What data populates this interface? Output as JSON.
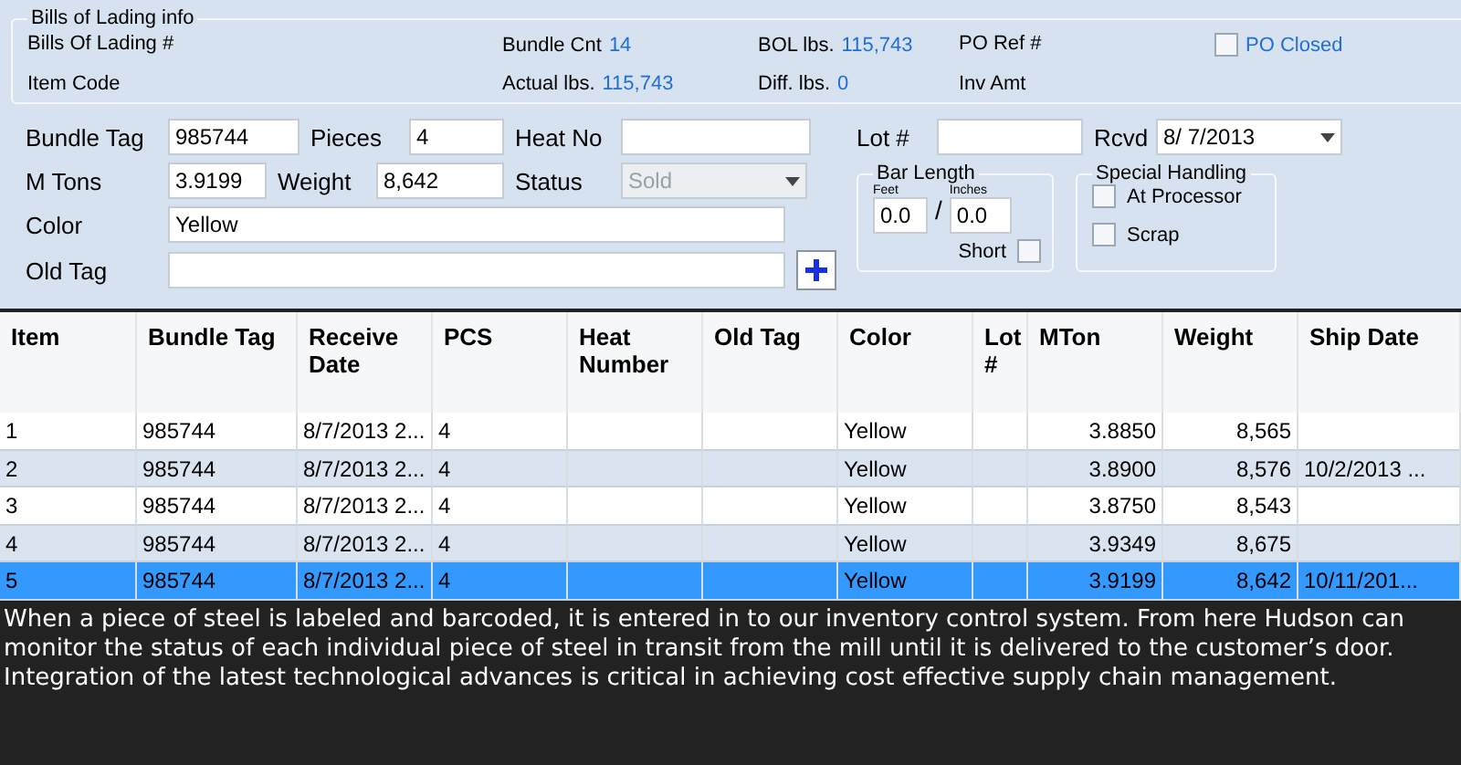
{
  "bol_info": {
    "title": "Bills of Lading info",
    "bol_label": "Bills Of Lading #",
    "item_code_label": "Item Code",
    "bundle_cnt_label": "Bundle Cnt",
    "bundle_cnt": "14",
    "actual_lbs_label": "Actual lbs.",
    "actual_lbs": "115,743",
    "bol_lbs_label": "BOL lbs.",
    "bol_lbs": "115,743",
    "diff_lbs_label": "Diff. lbs.",
    "diff_lbs": "0",
    "po_ref_label": "PO Ref #",
    "inv_amt_label": "Inv Amt",
    "po_closed": {
      "label": "PO Closed",
      "checked": false
    }
  },
  "form": {
    "bundle_tag": {
      "label": "Bundle Tag",
      "value": "985744"
    },
    "pieces": {
      "label": "Pieces",
      "value": "4"
    },
    "heat_no": {
      "label": "Heat No"
    },
    "lot": {
      "label": "Lot #"
    },
    "rcvd": {
      "label": "Rcvd",
      "value": "8/ 7/2013"
    },
    "m_tons": {
      "label": "M Tons",
      "value": "3.9199"
    },
    "weight": {
      "label": "Weight",
      "value": "8,642"
    },
    "status": {
      "label": "Status",
      "value": "Sold",
      "disabled": true
    },
    "color": {
      "label": "Color",
      "value": "Yellow"
    },
    "old_tag": {
      "label": "Old Tag"
    },
    "bar_length": {
      "title": "Bar Length",
      "feet_label": "Feet",
      "feet": "0.0",
      "separator": "/",
      "inches_label": "Inches",
      "inches": "0.0",
      "short": {
        "label": "Short",
        "checked": false
      }
    },
    "special_handling": {
      "title": "Special Handling",
      "options": [
        {
          "label": "At Processor",
          "checked": false
        },
        {
          "label": "Scrap",
          "checked": false
        }
      ]
    }
  },
  "table": {
    "columns": [
      "Item",
      "Bundle Tag",
      "Receive Date",
      "PCS",
      "Heat Number",
      "Old Tag",
      "Color",
      "Lot #",
      "MTon",
      "Weight",
      "Ship Date"
    ],
    "rows": [
      {
        "selected": false,
        "cells": [
          "1",
          "985744",
          "8/7/2013 2...",
          "4",
          "",
          "",
          "Yellow",
          "",
          "3.8850",
          "8,565",
          ""
        ]
      },
      {
        "selected": false,
        "cells": [
          "2",
          "985744",
          "8/7/2013 2...",
          "4",
          "",
          "",
          "Yellow",
          "",
          "3.8900",
          "8,576",
          "10/2/2013 ..."
        ]
      },
      {
        "selected": false,
        "cells": [
          "3",
          "985744",
          "8/7/2013 2...",
          "4",
          "",
          "",
          "Yellow",
          "",
          "3.8750",
          "8,543",
          ""
        ]
      },
      {
        "selected": false,
        "cells": [
          "4",
          "985744",
          "8/7/2013 2...",
          "4",
          "",
          "",
          "Yellow",
          "",
          "3.9349",
          "8,675",
          ""
        ]
      },
      {
        "selected": true,
        "cells": [
          "5",
          "985744",
          "8/7/2013 2...",
          "4",
          "",
          "",
          "Yellow",
          "",
          "3.9199",
          "8,642",
          "10/11/201..."
        ]
      }
    ]
  },
  "caption": "When a piece of steel is labeled and barcoded, it is entered in to our inventory control system. From here Hudson can monitor the status of each individual piece of steel in transit from the mill until it is delivered to the customer’s door. Integration of the latest technological advances is critical in achieving cost effective supply chain management."
}
